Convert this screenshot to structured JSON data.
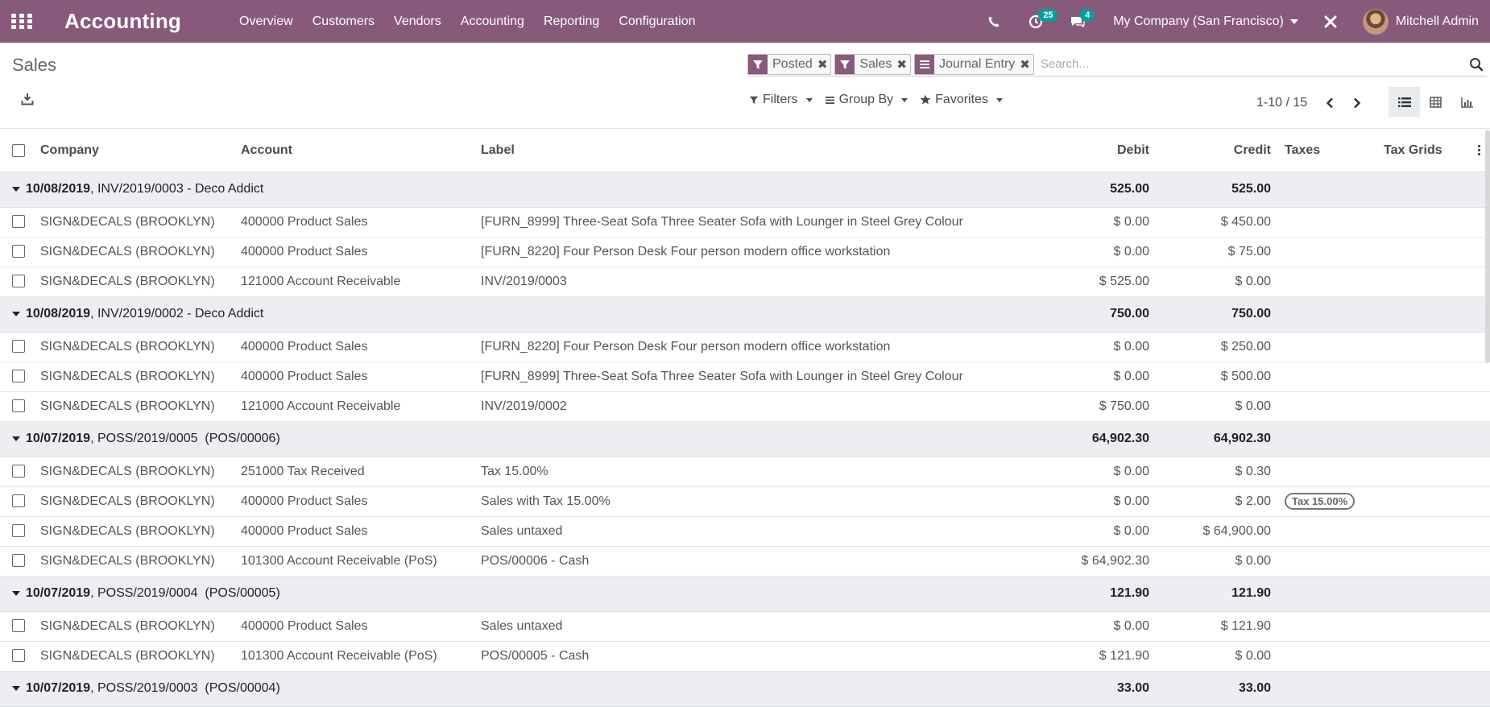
{
  "navbar": {
    "brand": "Accounting",
    "menu": [
      "Overview",
      "Customers",
      "Vendors",
      "Accounting",
      "Reporting",
      "Configuration"
    ],
    "activities_count": "25",
    "messages_count": "4",
    "company": "My Company (San Francisco)",
    "user": "Mitchell Admin",
    "accent_color": "#875a7b",
    "badge_color": "#00a09d"
  },
  "control_panel": {
    "breadcrumb": "Sales",
    "facets": [
      {
        "type": "filter",
        "value": "Posted"
      },
      {
        "type": "filter",
        "value": "Sales"
      },
      {
        "type": "groupby",
        "value": "Journal Entry"
      }
    ],
    "search_placeholder": "Search...",
    "filters_label": "Filters",
    "groupby_label": "Group By",
    "favorites_label": "Favorites",
    "pager": "1-10 / 15"
  },
  "table": {
    "columns": [
      "Company",
      "Account",
      "Label",
      "Debit",
      "Credit",
      "Taxes",
      "Tax Grids"
    ],
    "groups": [
      {
        "date": "10/08/2019",
        "rest": ", INV/2019/0003 - Deco Addict",
        "debit": "525.00",
        "credit": "525.00",
        "rows": [
          {
            "company": "SIGN&DECALS (BROOKLYN)",
            "account": "400000 Product Sales",
            "label": "[FURN_8999] Three-Seat Sofa Three Seater Sofa with Lounger in Steel Grey Colour",
            "debit": "$ 0.00",
            "credit": "$ 450.00",
            "tax": ""
          },
          {
            "company": "SIGN&DECALS (BROOKLYN)",
            "account": "400000 Product Sales",
            "label": "[FURN_8220] Four Person Desk Four person modern office workstation",
            "debit": "$ 0.00",
            "credit": "$ 75.00",
            "tax": ""
          },
          {
            "company": "SIGN&DECALS (BROOKLYN)",
            "account": "121000 Account Receivable",
            "label": "INV/2019/0003",
            "debit": "$ 525.00",
            "credit": "$ 0.00",
            "tax": ""
          }
        ]
      },
      {
        "date": "10/08/2019",
        "rest": ", INV/2019/0002 - Deco Addict",
        "debit": "750.00",
        "credit": "750.00",
        "rows": [
          {
            "company": "SIGN&DECALS (BROOKLYN)",
            "account": "400000 Product Sales",
            "label": "[FURN_8220] Four Person Desk Four person modern office workstation",
            "debit": "$ 0.00",
            "credit": "$ 250.00",
            "tax": ""
          },
          {
            "company": "SIGN&DECALS (BROOKLYN)",
            "account": "400000 Product Sales",
            "label": "[FURN_8999] Three-Seat Sofa Three Seater Sofa with Lounger in Steel Grey Colour",
            "debit": "$ 0.00",
            "credit": "$ 500.00",
            "tax": ""
          },
          {
            "company": "SIGN&DECALS (BROOKLYN)",
            "account": "121000 Account Receivable",
            "label": "INV/2019/0002",
            "debit": "$ 750.00",
            "credit": "$ 0.00",
            "tax": ""
          }
        ]
      },
      {
        "date": "10/07/2019",
        "rest": ", POSS/2019/0005  (POS/00006)",
        "debit": "64,902.30",
        "credit": "64,902.30",
        "rows": [
          {
            "company": "SIGN&DECALS (BROOKLYN)",
            "account": "251000 Tax Received",
            "label": "Tax 15.00%",
            "debit": "$ 0.00",
            "credit": "$ 0.30",
            "tax": ""
          },
          {
            "company": "SIGN&DECALS (BROOKLYN)",
            "account": "400000 Product Sales",
            "label": "Sales with Tax 15.00%",
            "debit": "$ 0.00",
            "credit": "$ 2.00",
            "tax": "Tax 15.00%"
          },
          {
            "company": "SIGN&DECALS (BROOKLYN)",
            "account": "400000 Product Sales",
            "label": "Sales untaxed",
            "debit": "$ 0.00",
            "credit": "$ 64,900.00",
            "tax": ""
          },
          {
            "company": "SIGN&DECALS (BROOKLYN)",
            "account": "101300 Account Receivable (PoS)",
            "label": "POS/00006 - Cash",
            "debit": "$ 64,902.30",
            "credit": "$ 0.00",
            "tax": ""
          }
        ]
      },
      {
        "date": "10/07/2019",
        "rest": ", POSS/2019/0004  (POS/00005)",
        "debit": "121.90",
        "credit": "121.90",
        "rows": [
          {
            "company": "SIGN&DECALS (BROOKLYN)",
            "account": "400000 Product Sales",
            "label": "Sales untaxed",
            "debit": "$ 0.00",
            "credit": "$ 121.90",
            "tax": ""
          },
          {
            "company": "SIGN&DECALS (BROOKLYN)",
            "account": "101300 Account Receivable (PoS)",
            "label": "POS/00005 - Cash",
            "debit": "$ 121.90",
            "credit": "$ 0.00",
            "tax": ""
          }
        ]
      },
      {
        "date": "10/07/2019",
        "rest": ", POSS/2019/0003  (POS/00004)",
        "debit": "33.00",
        "credit": "33.00",
        "rows": []
      }
    ]
  }
}
